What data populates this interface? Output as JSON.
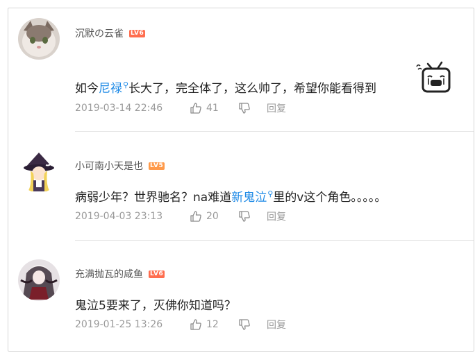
{
  "comments": [
    {
      "username": "沉默の云雀",
      "level": "LV6",
      "text_before": "如今",
      "link": "尼禄",
      "text_after": "长大了，完全体了，这么帅了，希望你能看得到",
      "emoji_icon": "tv-crying-emoji",
      "time": "2019-03-14 22:46",
      "likes": "41",
      "reply_label": "回复"
    },
    {
      "username": "小可南小天是也",
      "level": "LV5",
      "text_before": "病弱少年？世界驰名？na难道",
      "link": "新鬼泣",
      "text_after": "里的v这个角色。。。。。",
      "time": "2019-04-03 23:13",
      "likes": "20",
      "reply_label": "回复"
    },
    {
      "username": "充满抛瓦的咸鱼",
      "level": "LV6",
      "text_before": "鬼泣5要来了，灭佛你知道吗？",
      "time": "2019-01-25 13:26",
      "likes": "12",
      "reply_label": "回复"
    }
  ],
  "colors": {
    "link": "#1e8ae6",
    "lv6": "#ff6e4f",
    "lv5": "#ff9a4a",
    "meta": "#9a9a9a"
  }
}
